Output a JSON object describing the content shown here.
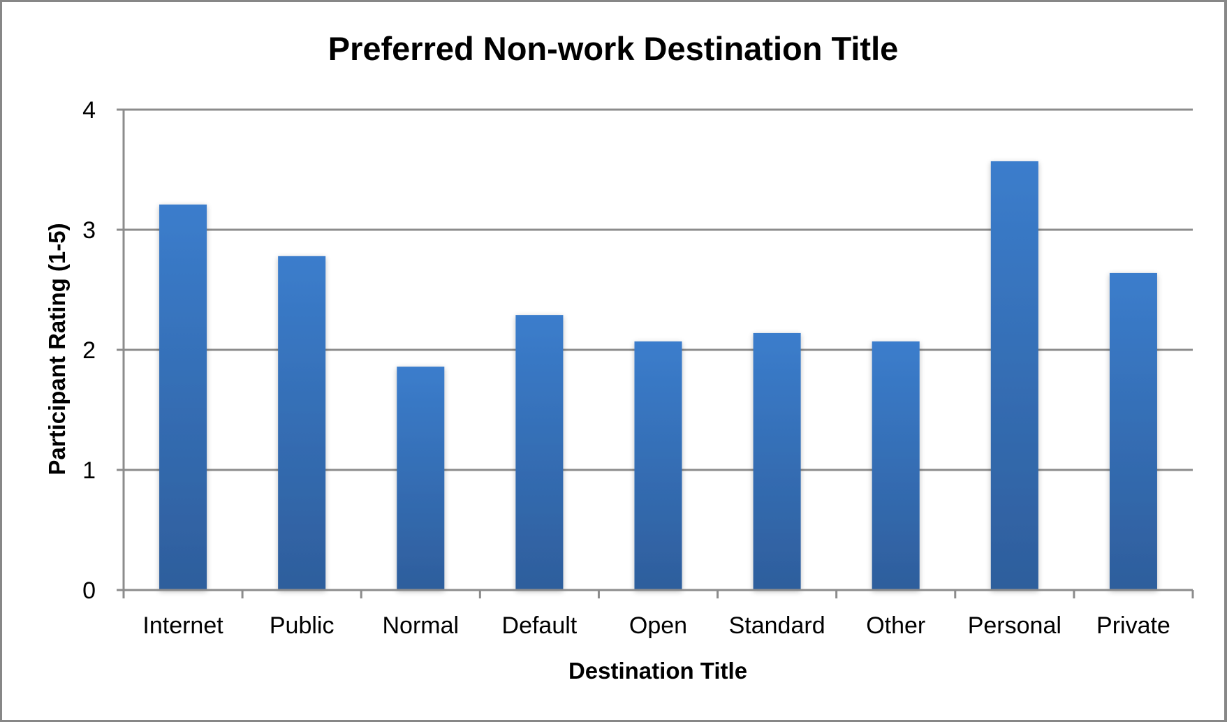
{
  "chart_data": {
    "type": "bar",
    "title": "Preferred Non-work Destination Title",
    "xlabel": "Destination Title",
    "ylabel": "Participant Rating (1-5)",
    "categories": [
      "Internet",
      "Public",
      "Normal",
      "Default",
      "Open",
      "Standard",
      "Other",
      "Personal",
      "Private"
    ],
    "values": [
      3.21,
      2.78,
      1.86,
      2.29,
      2.07,
      2.14,
      2.07,
      3.57,
      2.64
    ],
    "ylim": [
      0,
      4
    ],
    "yticks": [
      "0",
      "1",
      "2",
      "3",
      "4"
    ],
    "grid": true,
    "legend": "none",
    "colors": {
      "bar_top": "#3b7dcc",
      "bar_bottom": "#2e5e9c",
      "gridline": "#8c8c8c",
      "frame": "#878787"
    }
  }
}
